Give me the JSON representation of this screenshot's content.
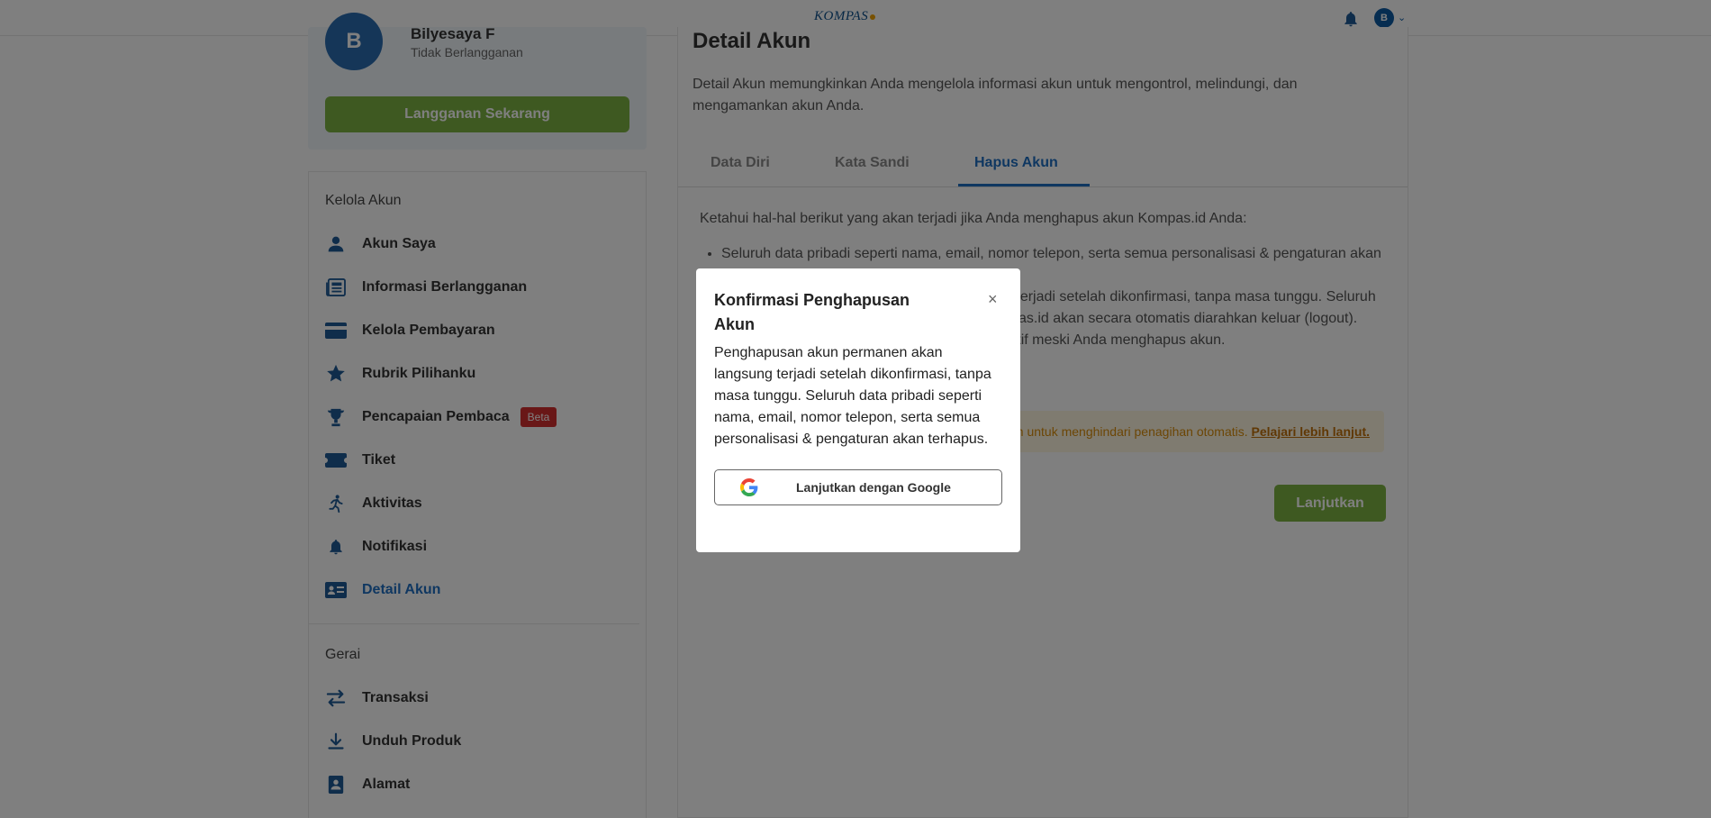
{
  "header": {
    "logo": "KOMPAS",
    "avatar_initial": "B"
  },
  "profile": {
    "avatar_initial": "B",
    "name": "Bilyesaya F",
    "status": "Tidak Berlangganan",
    "subscribe_label": "Langganan Sekarang"
  },
  "sidebar": {
    "section1": "Kelola Akun",
    "items": [
      {
        "label": "Akun Saya"
      },
      {
        "label": "Informasi Berlangganan"
      },
      {
        "label": "Kelola Pembayaran"
      },
      {
        "label": "Rubrik Pilihanku"
      },
      {
        "label": "Pencapaian Pembaca",
        "badge": "Beta"
      },
      {
        "label": "Tiket"
      },
      {
        "label": "Aktivitas"
      },
      {
        "label": "Notifikasi"
      },
      {
        "label": "Detail Akun"
      }
    ],
    "section2": "Gerai",
    "items2": [
      {
        "label": "Transaksi"
      },
      {
        "label": "Unduh Produk"
      },
      {
        "label": "Alamat"
      }
    ]
  },
  "main": {
    "title": "Detail Akun",
    "description": "Detail Akun memungkinkan Anda mengelola informasi akun untuk mengontrol, melindungi, dan mengamankan akun Anda.",
    "tabs": [
      {
        "label": "Data Diri"
      },
      {
        "label": "Kata Sandi"
      },
      {
        "label": "Hapus Akun"
      }
    ],
    "info_text": "Ketahui hal-hal berikut yang akan terjadi jika Anda menghapus akun Kompas.id Anda:",
    "bullets": [
      "Seluruh data pribadi seperti nama, email, nomor telepon, serta semua personalisasi & pengaturan akan terhapus.",
      "Penghapusan akun permanen akan langsung terjadi setelah dikonfirmasi, tanpa masa tunggu. Seluruh perangkat yang terhubung dengan akun Kompas.id akan secara otomatis diarahkan keluar (logout).",
      "Langganan yang masih berjalan akan tetap aktif meski Anda menghapus akun."
    ],
    "warning_text": "Hentikan langganan untuk menghindari penagihan otomatis.",
    "warning_link": "Pelajari lebih lanjut.",
    "continue_label": "Lanjutkan"
  },
  "modal": {
    "title": "Konfirmasi Penghapusan Akun",
    "close": "×",
    "body": "Penghapusan akun permanen akan langsung terjadi setelah dikonfirmasi, tanpa masa tunggu. Seluruh data pribadi seperti nama, email, nomor telepon, serta semua personalisasi & pengaturan akan terhapus.",
    "google_label": "Lanjutkan dengan Google"
  },
  "colors": {
    "accent_blue": "#1e6fc2",
    "green": "#7cb342",
    "badge_red": "#d32f2f"
  }
}
